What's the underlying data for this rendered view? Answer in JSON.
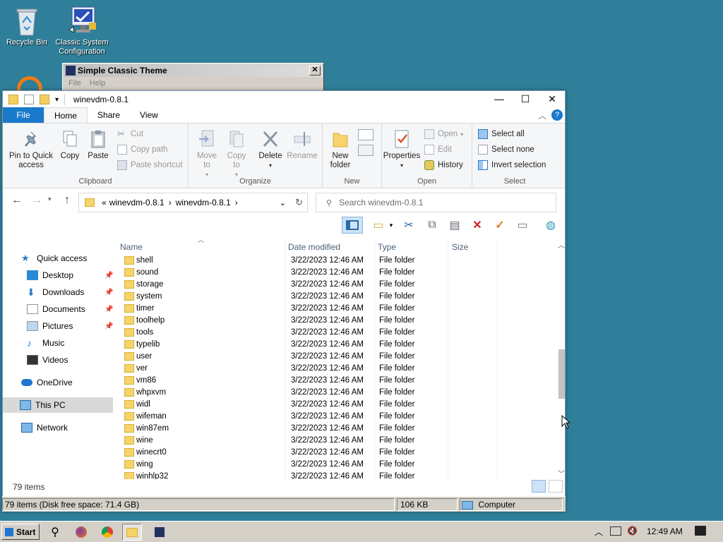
{
  "desktop": {
    "recycle_bin": "Recycle Bin",
    "classic_config": "Classic System Configuration"
  },
  "theme_window": {
    "title": "Simple Classic Theme",
    "close": "✕",
    "menu": [
      "File",
      "Help"
    ]
  },
  "explorer": {
    "title": "winevdm-0.8.1",
    "tabs": [
      "File",
      "Home",
      "Share",
      "View"
    ],
    "ribbon": {
      "clipboard": {
        "label": "Clipboard",
        "pin": "Pin to Quick access",
        "copy": "Copy",
        "paste": "Paste",
        "cut": "Cut",
        "copy_path": "Copy path",
        "paste_shortcut": "Paste shortcut"
      },
      "organize": {
        "label": "Organize",
        "move_to": "Move to",
        "copy_to": "Copy to",
        "delete": "Delete",
        "rename": "Rename"
      },
      "new": {
        "label": "New",
        "new_folder": "New folder"
      },
      "open": {
        "label": "Open",
        "properties": "Properties",
        "open": "Open",
        "edit": "Edit",
        "history": "History"
      },
      "select": {
        "label": "Select",
        "select_all": "Select all",
        "select_none": "Select none",
        "invert": "Invert selection"
      }
    },
    "address": {
      "prefix": "«",
      "crumbs": [
        "winevdm-0.8.1",
        "winevdm-0.8.1"
      ],
      "search_placeholder": "Search winevdm-0.8.1"
    },
    "nav": {
      "quick_access": "Quick access",
      "desktop": "Desktop",
      "downloads": "Downloads",
      "documents": "Documents",
      "pictures": "Pictures",
      "music": "Music",
      "videos": "Videos",
      "onedrive": "OneDrive",
      "this_pc": "This PC",
      "network": "Network"
    },
    "columns": [
      "Name",
      "Date modified",
      "Type",
      "Size"
    ],
    "files": [
      {
        "name": "shell",
        "date": "3/22/2023 12:46 AM",
        "type": "File folder"
      },
      {
        "name": "sound",
        "date": "3/22/2023 12:46 AM",
        "type": "File folder"
      },
      {
        "name": "storage",
        "date": "3/22/2023 12:46 AM",
        "type": "File folder"
      },
      {
        "name": "system",
        "date": "3/22/2023 12:46 AM",
        "type": "File folder"
      },
      {
        "name": "timer",
        "date": "3/22/2023 12:46 AM",
        "type": "File folder"
      },
      {
        "name": "toolhelp",
        "date": "3/22/2023 12:46 AM",
        "type": "File folder"
      },
      {
        "name": "tools",
        "date": "3/22/2023 12:46 AM",
        "type": "File folder"
      },
      {
        "name": "typelib",
        "date": "3/22/2023 12:46 AM",
        "type": "File folder"
      },
      {
        "name": "user",
        "date": "3/22/2023 12:46 AM",
        "type": "File folder"
      },
      {
        "name": "ver",
        "date": "3/22/2023 12:46 AM",
        "type": "File folder"
      },
      {
        "name": "vm86",
        "date": "3/22/2023 12:46 AM",
        "type": "File folder"
      },
      {
        "name": "whpxvm",
        "date": "3/22/2023 12:46 AM",
        "type": "File folder"
      },
      {
        "name": "widl",
        "date": "3/22/2023 12:46 AM",
        "type": "File folder"
      },
      {
        "name": "wifeman",
        "date": "3/22/2023 12:46 AM",
        "type": "File folder"
      },
      {
        "name": "win87em",
        "date": "3/22/2023 12:46 AM",
        "type": "File folder"
      },
      {
        "name": "wine",
        "date": "3/22/2023 12:46 AM",
        "type": "File folder"
      },
      {
        "name": "winecrt0",
        "date": "3/22/2023 12:46 AM",
        "type": "File folder"
      },
      {
        "name": "wing",
        "date": "3/22/2023 12:46 AM",
        "type": "File folder"
      },
      {
        "name": "winhlp32",
        "date": "3/22/2023 12:46 AM",
        "type": "File folder"
      }
    ],
    "item_count": "79 items",
    "status": {
      "left": "79 items (Disk free space: 71.4 GB)",
      "size": "106 KB",
      "location": "Computer"
    }
  },
  "taskbar": {
    "start": "Start",
    "clock": "12:49 AM"
  },
  "colors": {
    "desktop": "#2f7f9a",
    "file_tab": "#1979ca",
    "folder": "#f6d36b"
  }
}
